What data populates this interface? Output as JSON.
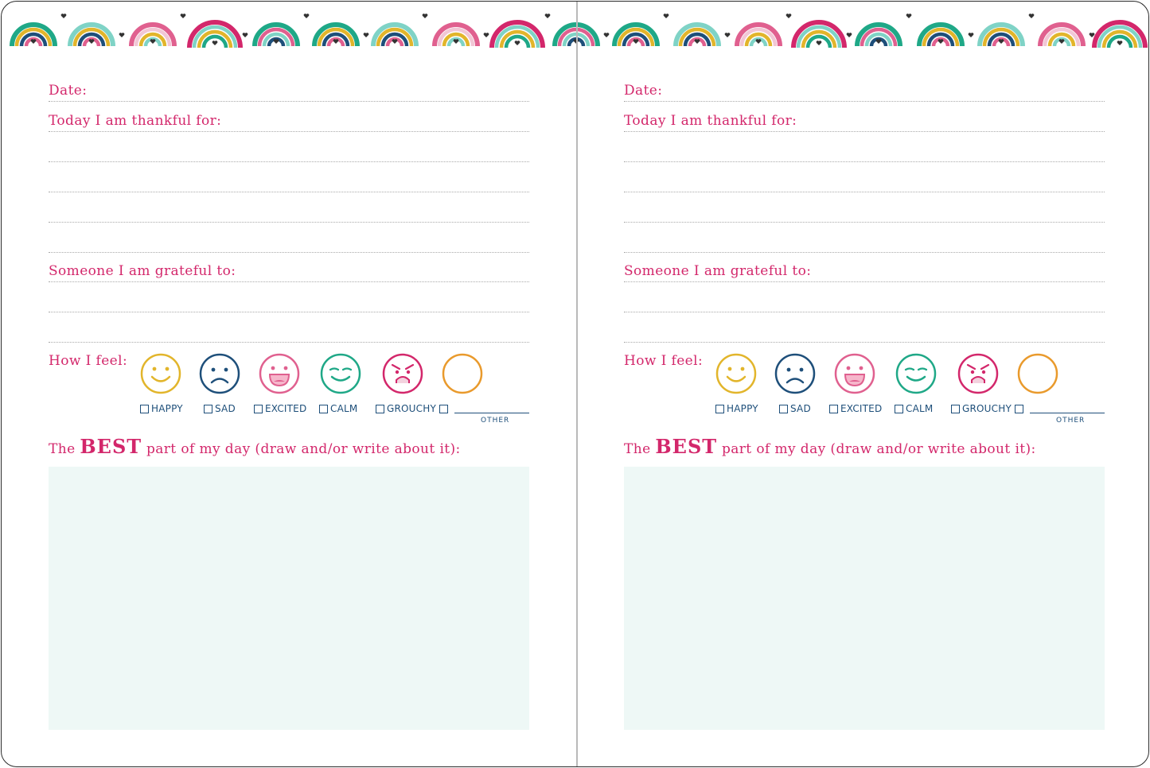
{
  "colors": {
    "heading": "#d3276b",
    "checkbox_text": "#1e4f7a",
    "happy": "#e2b52b",
    "sad": "#1e4f7a",
    "excited": "#e0608f",
    "calm": "#1fa887",
    "grouchy": "#d3276b",
    "other": "#e99a2c",
    "draw_box": "#eef8f6"
  },
  "decoration": {
    "border_motif": "rainbow-border"
  },
  "pages": [
    {
      "date_label": "Date:",
      "thankful_label": "Today I am thankful for:",
      "grateful_label": "Someone I am grateful to:",
      "feel_label": "How I feel:",
      "feelings": [
        {
          "label": "HAPPY",
          "icon": "happy-face-icon"
        },
        {
          "label": "SAD",
          "icon": "sad-face-icon"
        },
        {
          "label": "EXCITED",
          "icon": "excited-face-icon"
        },
        {
          "label": "CALM",
          "icon": "calm-face-icon"
        },
        {
          "label": "GROUCHY",
          "icon": "grouchy-face-icon"
        },
        {
          "label": "",
          "icon": "blank-face-icon"
        }
      ],
      "other_label": "OTHER",
      "best_prefix": "The ",
      "best_emphasis": "BEST",
      "best_suffix": " part of my day (draw and/or write about it):"
    },
    {
      "date_label": "Date:",
      "thankful_label": "Today I am thankful for:",
      "grateful_label": "Someone I am grateful to:",
      "feel_label": "How I feel:",
      "feelings": [
        {
          "label": "HAPPY",
          "icon": "happy-face-icon"
        },
        {
          "label": "SAD",
          "icon": "sad-face-icon"
        },
        {
          "label": "EXCITED",
          "icon": "excited-face-icon"
        },
        {
          "label": "CALM",
          "icon": "calm-face-icon"
        },
        {
          "label": "GROUCHY",
          "icon": "grouchy-face-icon"
        },
        {
          "label": "",
          "icon": "blank-face-icon"
        }
      ],
      "other_label": "OTHER",
      "best_prefix": "The ",
      "best_emphasis": "BEST",
      "best_suffix": " part of my day (draw and/or write about it):"
    }
  ]
}
